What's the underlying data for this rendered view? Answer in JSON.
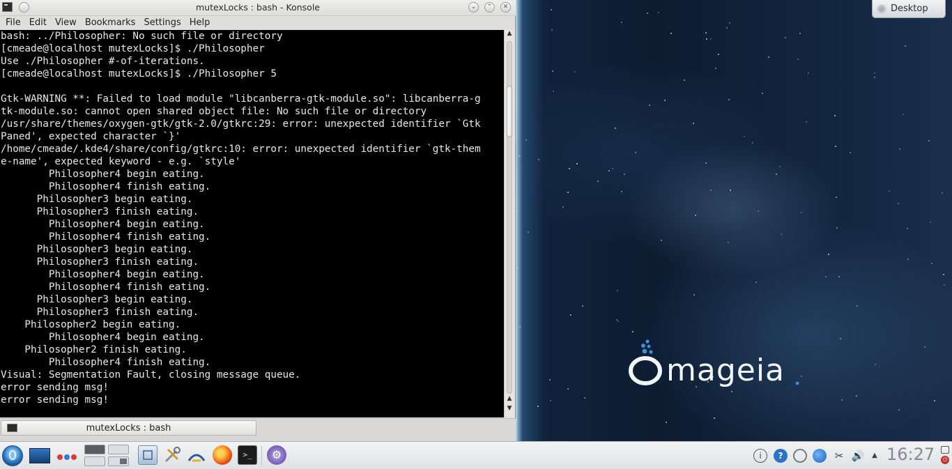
{
  "window": {
    "title": "mutexLocks : bash - Konsole",
    "buttons": {
      "minimize": "⌄",
      "maximize": "⌃",
      "close": "✕"
    }
  },
  "menu": [
    "File",
    "Edit",
    "View",
    "Bookmarks",
    "Settings",
    "Help"
  ],
  "terminal": {
    "lines": [
      "bash: ../Philosopher: No such file or directory",
      "[cmeade@localhost mutexLocks]$ ./Philosopher",
      "Use ./Philosopher #-of-iterations.",
      "[cmeade@localhost mutexLocks]$ ./Philosopher 5",
      "",
      "Gtk-WARNING **: Failed to load module \"libcanberra-gtk-module.so\": libcanberra-g",
      "tk-module.so: cannot open shared object file: No such file or directory",
      "/usr/share/themes/oxygen-gtk/gtk-2.0/gtkrc:29: error: unexpected identifier `Gtk",
      "Paned', expected character `}'",
      "/home/cmeade/.kde4/share/config/gtkrc:10: error: unexpected identifier `gtk-them",
      "e-name', expected keyword - e.g. `style'",
      "        Philosopher4 begin eating.",
      "        Philosopher4 finish eating.",
      "      Philosopher3 begin eating.",
      "      Philosopher3 finish eating.",
      "        Philosopher4 begin eating.",
      "        Philosopher4 finish eating.",
      "      Philosopher3 begin eating.",
      "      Philosopher3 finish eating.",
      "        Philosopher4 begin eating.",
      "        Philosopher4 finish eating.",
      "      Philosopher3 begin eating.",
      "      Philosopher3 finish eating.",
      "    Philosopher2 begin eating.",
      "        Philosopher4 begin eating.",
      "    Philosopher2 finish eating.",
      "        Philosopher4 finish eating.",
      "Visual: Segmentation Fault, closing message queue.",
      "error sending msg!",
      "error sending msg!"
    ]
  },
  "tab": {
    "label": "mutexLocks : bash"
  },
  "desktop": {
    "button_label": "Desktop",
    "logo_text": "mageia"
  },
  "taskbar": {
    "terminal_glyph": ">_",
    "clock": "16:27",
    "tray": {
      "info": "i",
      "help": "?",
      "clip": "✂",
      "volume": "🔊",
      "arrow": "▲"
    }
  },
  "colors": {
    "terminal_bg": "#000000",
    "terminal_fg": "#e8e8e8",
    "accent": "#2b73c6",
    "logo_blue": "#3e8fd6"
  }
}
